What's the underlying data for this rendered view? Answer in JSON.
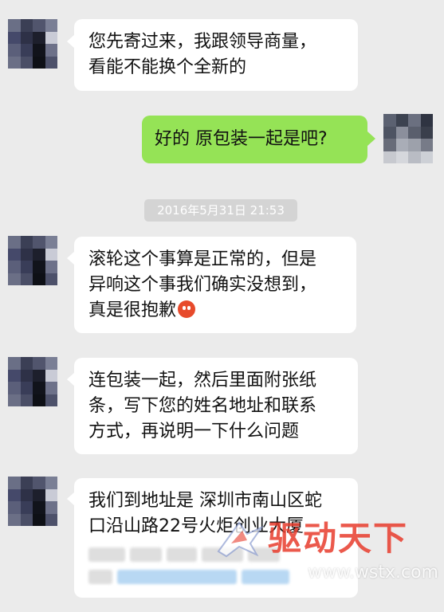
{
  "messages": [
    {
      "lines": [
        "您先寄过来，我跟领导商量，",
        "看能不能换个全新的"
      ]
    },
    {
      "lines": [
        "好的  原包装一起是吧?"
      ]
    },
    {
      "lines": [
        "滚轮这个事算是正常的，但是",
        "异响这个事我们确实没想到，",
        "真是很抱歉"
      ],
      "emoji": "embarrassed-face-emoji"
    },
    {
      "lines": [
        "连包装一起，然后里面附张纸",
        "条，写下您的姓名地址和联系",
        "方式，再说明一下什么问题"
      ]
    },
    {
      "lines": [
        "我们到地址是 深圳市南山区蛇",
        "口沿山路22号火炬创业大厦"
      ]
    }
  ],
  "timestamp": "2016年5月31日 21:53",
  "watermark": {
    "name": "驱动天下",
    "url": "www.wstx.com"
  },
  "colors": {
    "background": "#ebebeb",
    "bubble_left": "#ffffff",
    "bubble_right": "#95e356",
    "timestamp_bg": "#d4d4d4"
  }
}
